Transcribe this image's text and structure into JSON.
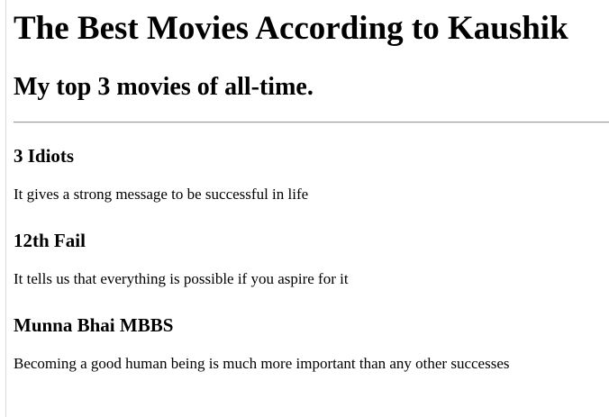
{
  "header": {
    "title": "The Best Movies According to Kaushik",
    "subtitle": "My top 3 movies of all-time."
  },
  "movies": [
    {
      "title": "3 Idiots",
      "description": "It gives a strong message to be successful in life"
    },
    {
      "title": "12th Fail",
      "description": "It tells us that everything is possible if you aspire for it"
    },
    {
      "title": "Munna Bhai MBBS",
      "description": "Becoming a good human being is much more important than any other successes"
    }
  ]
}
